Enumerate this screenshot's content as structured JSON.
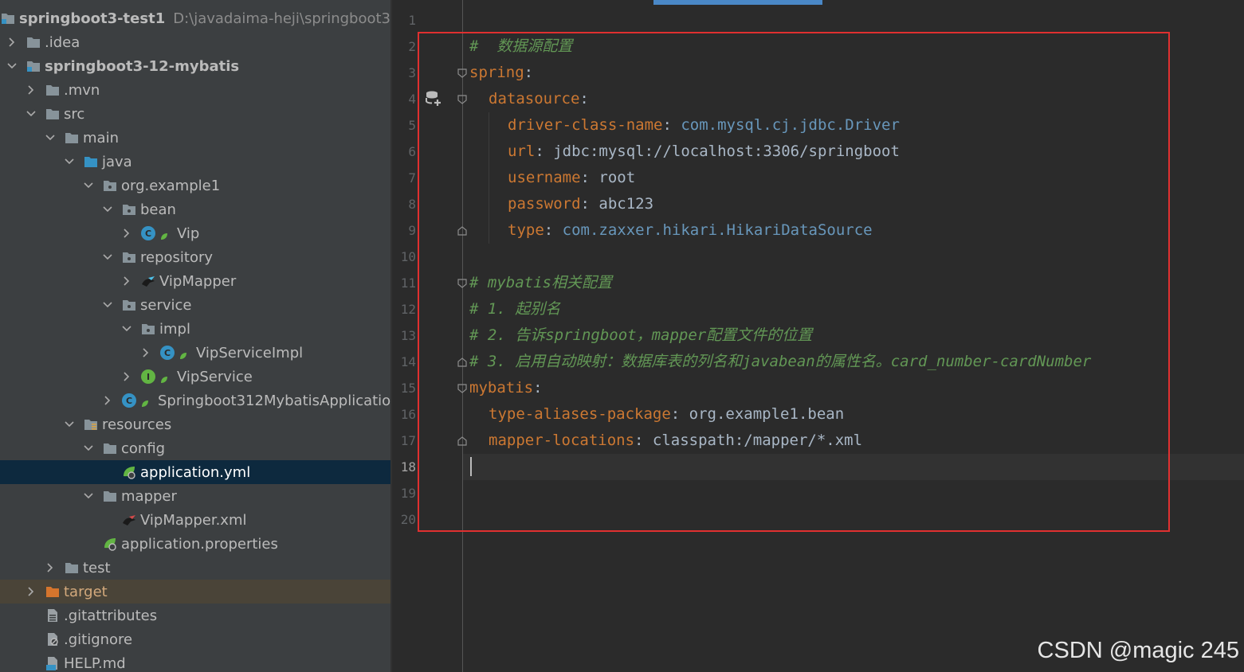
{
  "project": {
    "name": "springboot3-test1",
    "path": "D:\\javadaima-heji\\springboot3-t"
  },
  "tree": [
    {
      "label": ".idea"
    },
    {
      "label": "springboot3-12-mybatis"
    },
    {
      "label": ".mvn"
    },
    {
      "label": "src"
    },
    {
      "label": "main"
    },
    {
      "label": "java"
    },
    {
      "label": "org.example1"
    },
    {
      "label": "bean"
    },
    {
      "label": "Vip"
    },
    {
      "label": "repository"
    },
    {
      "label": "VipMapper"
    },
    {
      "label": "service"
    },
    {
      "label": "impl"
    },
    {
      "label": "VipServiceImpl"
    },
    {
      "label": "VipService"
    },
    {
      "label": "Springboot312MybatisApplicatio"
    },
    {
      "label": "resources"
    },
    {
      "label": "config"
    },
    {
      "label": "application.yml"
    },
    {
      "label": "mapper"
    },
    {
      "label": "VipMapper.xml"
    },
    {
      "label": "application.properties"
    },
    {
      "label": "test"
    },
    {
      "label": "target"
    },
    {
      "label": ".gitattributes"
    },
    {
      "label": ".gitignore"
    },
    {
      "label": "HELP.md"
    }
  ],
  "badges": {
    "class": "C",
    "interface": "I"
  },
  "editor": {
    "current_line": 18,
    "line_numbers": [
      "1",
      "2",
      "3",
      "4",
      "5",
      "6",
      "7",
      "8",
      "9",
      "10",
      "11",
      "12",
      "13",
      "14",
      "15",
      "16",
      "17",
      "18",
      "19",
      "20"
    ],
    "lines": {
      "l2": {
        "comment": "#  数据源配置"
      },
      "l3": {
        "key": "spring",
        "colon": ":"
      },
      "l4": {
        "key": "datasource",
        "colon": ":"
      },
      "l5": {
        "key": "driver-class-name",
        "colon": ": ",
        "value": "com.mysql.cj.jdbc.Driver"
      },
      "l6": {
        "key": "url",
        "colon": ": ",
        "value": "jdbc:mysql://localhost:3306/springboot"
      },
      "l7": {
        "key": "username",
        "colon": ": ",
        "value": "root"
      },
      "l8": {
        "key": "password",
        "colon": ": ",
        "value": "abc123"
      },
      "l9": {
        "key": "type",
        "colon": ": ",
        "value": "com.zaxxer.hikari.HikariDataSource"
      },
      "l11": {
        "comment": "# mybatis相关配置"
      },
      "l12": {
        "comment": "# 1. 起别名"
      },
      "l13": {
        "comment": "# 2. 告诉springboot，mapper配置文件的位置"
      },
      "l14": {
        "comment": "# 3. 启用自动映射：数据库表的列名和javabean的属性名。card_number-cardNumber"
      },
      "l15": {
        "key": "mybatis",
        "colon": ":"
      },
      "l16": {
        "key": "type-aliases-package",
        "colon": ": ",
        "value": "org.example1.bean"
      },
      "l17": {
        "key": "mapper-locations",
        "colon": ": ",
        "value": "classpath:/mapper/*.xml"
      }
    }
  },
  "watermark": "CSDN @magic 245",
  "colors": {
    "tree_bg": "#3c3f41",
    "editor_bg": "#2b2b2b",
    "selection": "#0d293e",
    "key": "#cc7832",
    "comment": "#629755",
    "highlight_box": "#e03030"
  }
}
